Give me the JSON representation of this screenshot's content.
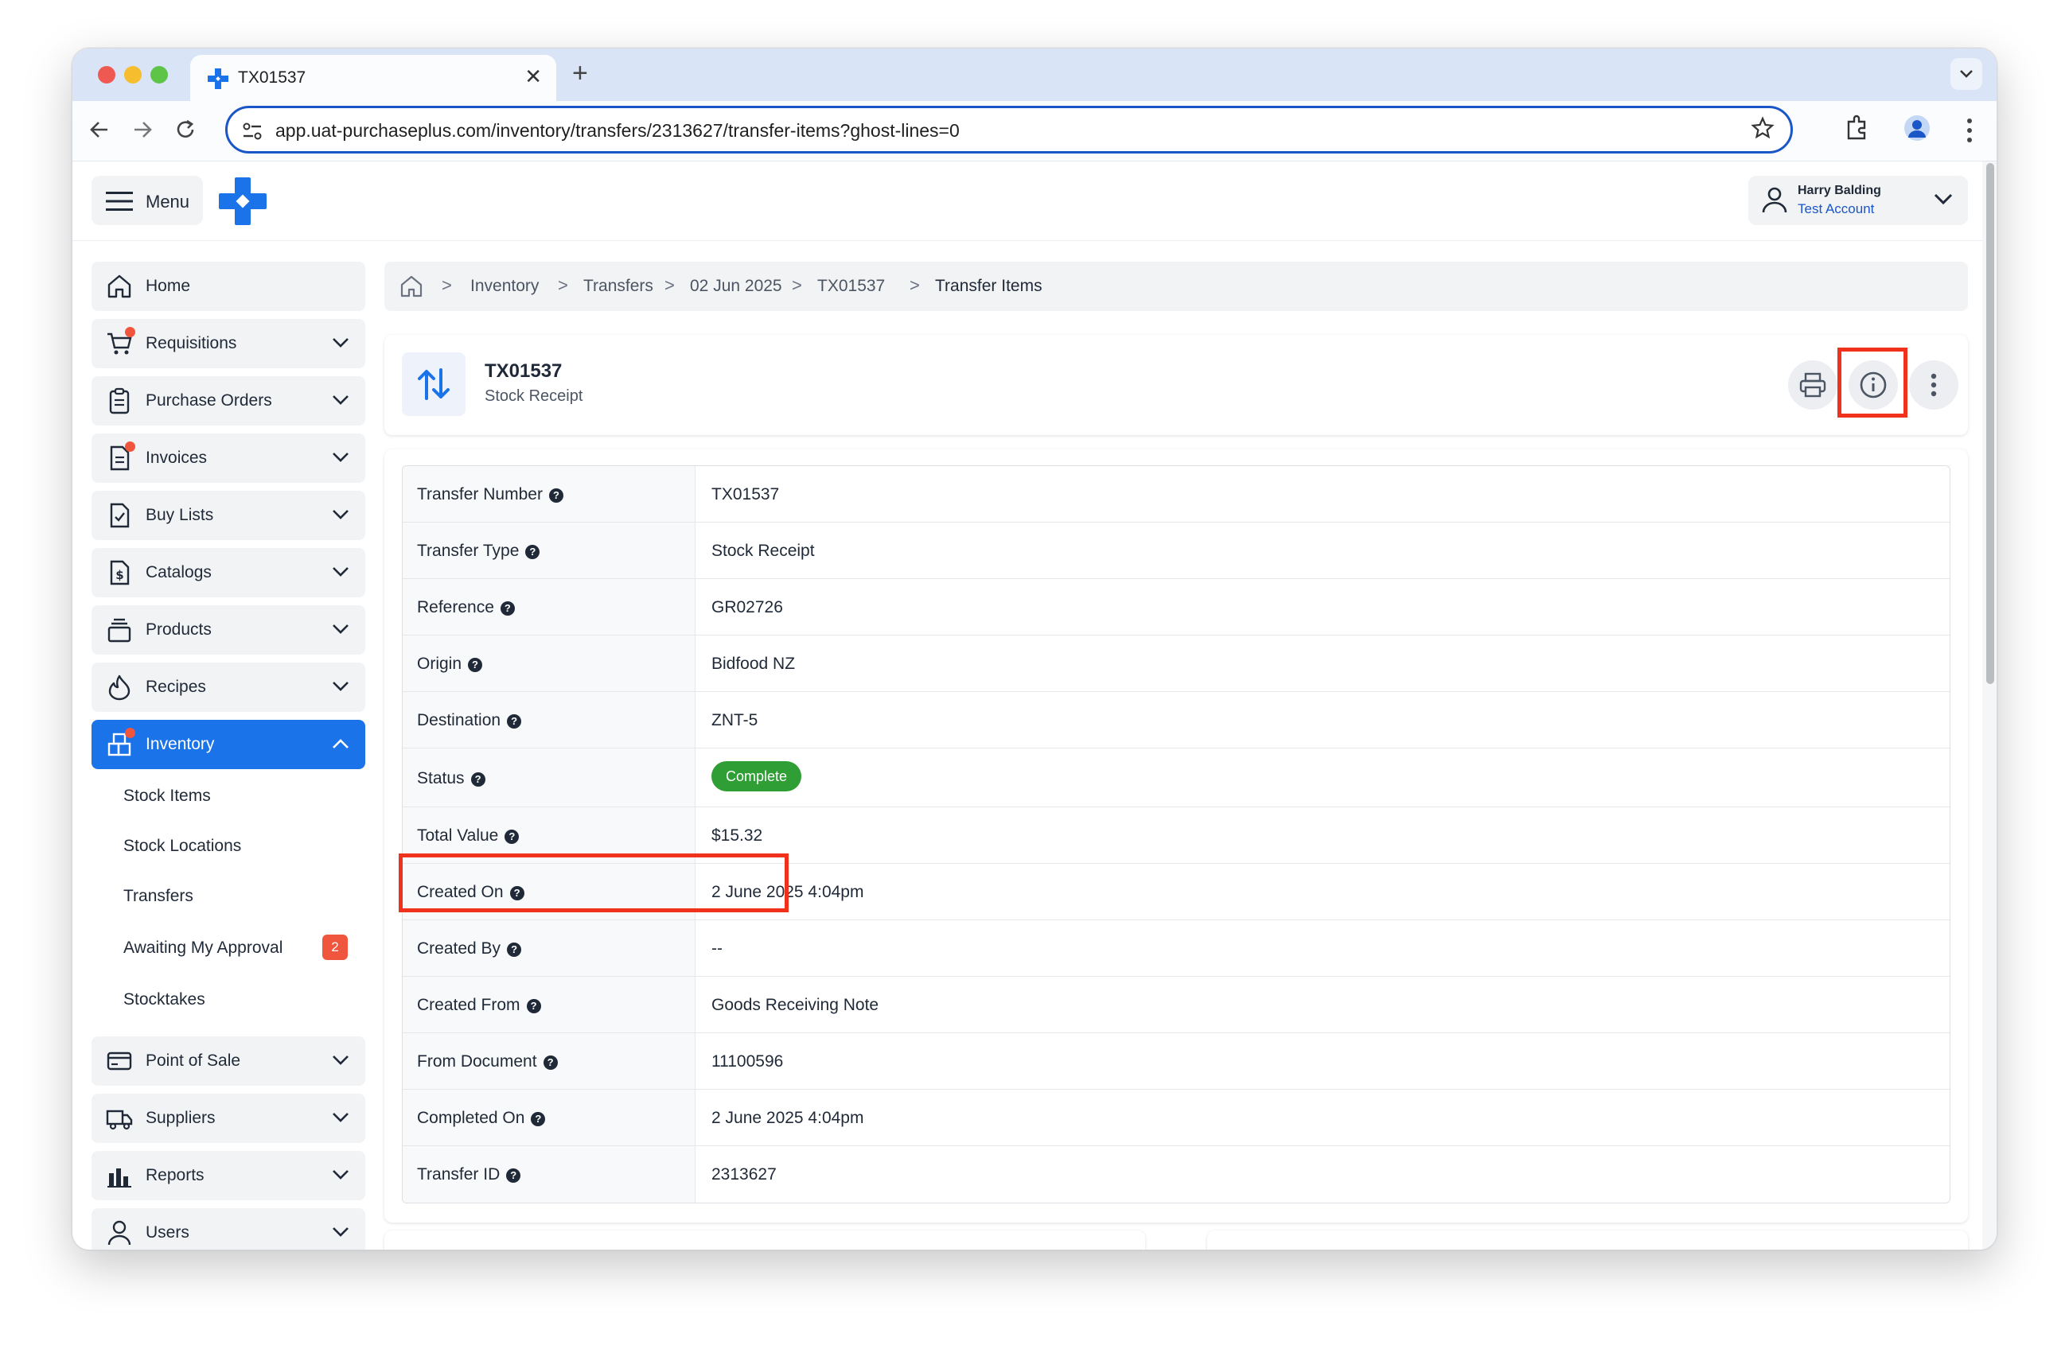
{
  "browser": {
    "tab_title": "TX01537",
    "new_tab_glyph": "+",
    "close_glyph": "✕",
    "url": "app.uat-purchaseplus.com/inventory/transfers/2313627/transfer-items?ghost-lines=0",
    "icons": [
      "back-icon",
      "forward-icon",
      "reload-icon",
      "site-settings-icon",
      "star-icon",
      "extensions-icon",
      "profile-icon",
      "kebab-icon"
    ]
  },
  "header": {
    "menu_label": "Menu",
    "user_name": "Harry Balding",
    "user_account": "Test Account",
    "accent_color": "#1a73e8"
  },
  "sidebar": {
    "items": [
      {
        "label": "Home",
        "icon": "home-icon"
      },
      {
        "label": "Requisitions",
        "icon": "cart-icon"
      },
      {
        "label": "Purchase Orders",
        "icon": "clipboard-icon"
      },
      {
        "label": "Invoices",
        "icon": "invoice-icon"
      },
      {
        "label": "Buy Lists",
        "icon": "checklist-icon"
      },
      {
        "label": "Catalogs",
        "icon": "dollar-doc-icon"
      },
      {
        "label": "Products",
        "icon": "box-stack-icon"
      },
      {
        "label": "Recipes",
        "icon": "flame-icon"
      },
      {
        "label": "Inventory",
        "icon": "inventory-icon"
      },
      {
        "label": "Point of Sale",
        "icon": "card-icon"
      },
      {
        "label": "Suppliers",
        "icon": "truck-icon"
      },
      {
        "label": "Reports",
        "icon": "bar-chart-icon"
      },
      {
        "label": "Users",
        "icon": "user-icon"
      }
    ],
    "inventory_sub": [
      "Stock Items",
      "Stock Locations",
      "Transfers",
      "Awaiting My Approval",
      "Stocktakes"
    ],
    "awaiting_count": "2"
  },
  "breadcrumb": [
    "Inventory",
    "Transfers",
    "02 Jun 2025",
    "TX01537",
    "Transfer Items"
  ],
  "breadcrumb_sep": ">",
  "transfer": {
    "title": "TX01537",
    "subtitle": "Stock Receipt"
  },
  "details": {
    "rows": [
      {
        "label": "Transfer Number",
        "value": "TX01537"
      },
      {
        "label": "Transfer Type",
        "value": "Stock Receipt"
      },
      {
        "label": "Reference",
        "value": "GR02726"
      },
      {
        "label": "Origin",
        "value": "Bidfood NZ"
      },
      {
        "label": "Destination",
        "value": "ZNT-5"
      },
      {
        "label": "Status",
        "value": "Complete"
      },
      {
        "label": "Total Value",
        "value": "$15.32"
      },
      {
        "label": "Created On",
        "value": "2 June 2025 4:04pm"
      },
      {
        "label": "Created By",
        "value": "--"
      },
      {
        "label": "Created From",
        "value": "Goods Receiving Note"
      },
      {
        "label": "From Document",
        "value": "11100596"
      },
      {
        "label": "Completed On",
        "value": "2 June 2025 4:04pm"
      },
      {
        "label": "Transfer ID",
        "value": "2313627"
      }
    ],
    "help_glyph": "?"
  },
  "colors": {
    "status_complete": "#2e9e35",
    "highlight": "#f0321c",
    "badge": "#f0563d"
  }
}
